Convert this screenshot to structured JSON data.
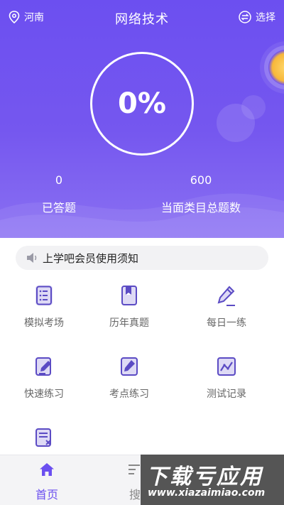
{
  "header": {
    "location": "河南",
    "title": "网络技术",
    "select_label": "选择"
  },
  "progress": {
    "value_text": "0%",
    "value": 0
  },
  "stats": {
    "answered_count": "0",
    "answered_label": "已答题",
    "total_count": "600",
    "total_label": "当面类目总题数"
  },
  "notice": {
    "text": "上学吧会员使用须知"
  },
  "menu": {
    "items": [
      {
        "label": "模拟考场",
        "icon": "list-doc-icon"
      },
      {
        "label": "历年真题",
        "icon": "book-icon"
      },
      {
        "label": "每日一练",
        "icon": "pencil-icon"
      },
      {
        "label": "快速练习",
        "icon": "edit-doc-icon"
      },
      {
        "label": "考点练习",
        "icon": "notebook-pen-icon"
      },
      {
        "label": "测试记录",
        "icon": "chart-icon"
      },
      {
        "label": "",
        "icon": "wrong-doc-icon"
      }
    ]
  },
  "tabbar": {
    "home_label": "首页",
    "search_label": "搜"
  },
  "watermark": {
    "title": "下载亏应用",
    "url": "www.xiazaimiao.com"
  },
  "colors": {
    "accent": "#6b4ff0",
    "hero_top": "#6c4ff0",
    "hero_bottom": "#8a70f2",
    "icon_fill": "#7b6cd9"
  }
}
